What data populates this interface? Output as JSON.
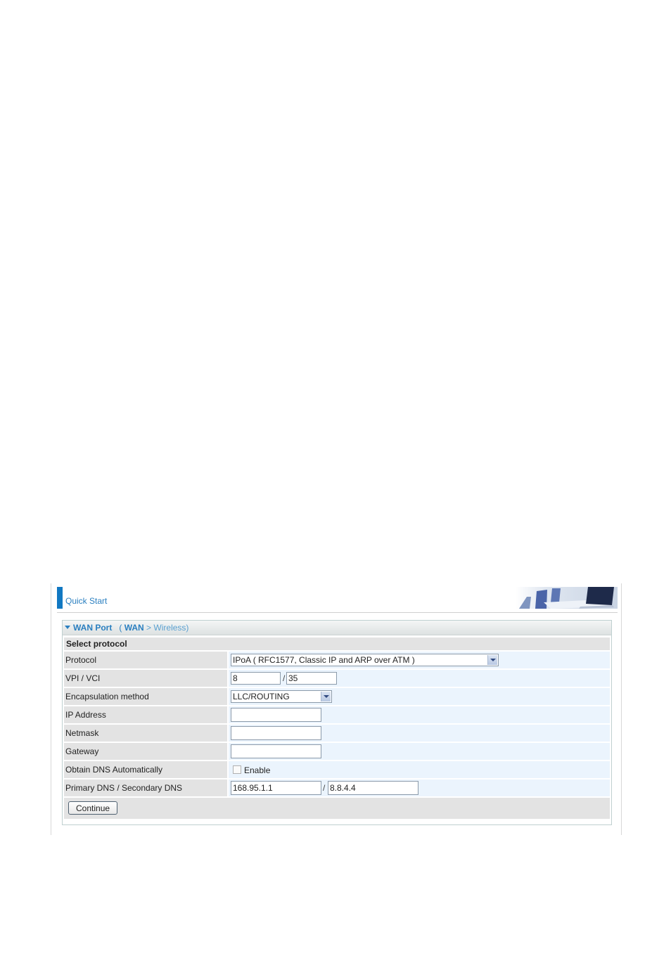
{
  "header": {
    "title": "Quick Start"
  },
  "panel": {
    "title": "WAN Port",
    "breadcrumb_open": "(",
    "breadcrumb_current": "WAN",
    "breadcrumb_sep": ">",
    "breadcrumb_next": "Wireless)"
  },
  "form": {
    "section_label": "Select protocol",
    "protocol": {
      "label": "Protocol",
      "value": "IPoA ( RFC1577, Classic IP and ARP over ATM )"
    },
    "vpi_vci": {
      "label": "VPI / VCI",
      "vpi": "8",
      "separator": "/",
      "vci": "35"
    },
    "encapsulation": {
      "label": "Encapsulation method",
      "value": "LLC/ROUTING"
    },
    "ip_address": {
      "label": "IP Address",
      "value": ""
    },
    "netmask": {
      "label": "Netmask",
      "value": ""
    },
    "gateway": {
      "label": "Gateway",
      "value": ""
    },
    "obtain_dns": {
      "label": "Obtain DNS Automatically",
      "checkbox_label": "Enable",
      "checked": false
    },
    "dns": {
      "label": "Primary DNS / Secondary DNS",
      "primary": "168.95.1.1",
      "separator": "/",
      "secondary": "8.8.4.4"
    },
    "continue_label": "Continue"
  }
}
